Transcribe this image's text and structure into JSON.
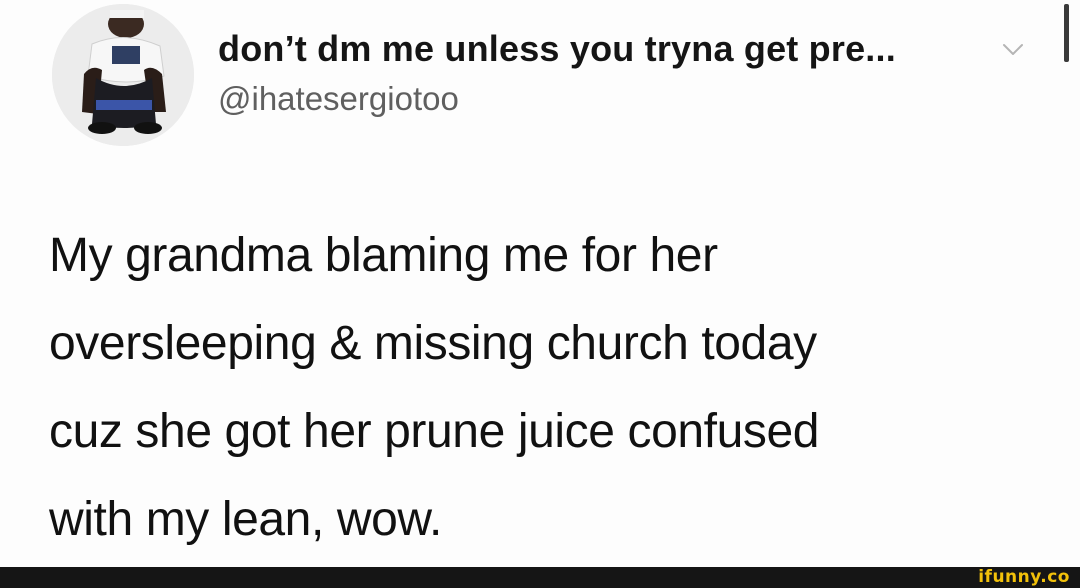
{
  "tweet": {
    "display_name": "don’t dm me unless you tryna get pre...",
    "handle": "@ihatesergiotoo",
    "text_lines": [
      "My grandma blaming me for her",
      "oversleeping & missing church today",
      "cuz she got her prune juice confused",
      "with my lean, wow."
    ]
  },
  "icons": {
    "menu": "chevron-down-icon",
    "avatar": "avatar-photo"
  },
  "footer": {
    "watermark": "ifunny.co"
  },
  "colors": {
    "background": "#ffffff",
    "text": "#111111",
    "handle": "#5f5f5f",
    "footer": "#151515",
    "watermark": "#f2c10a"
  }
}
